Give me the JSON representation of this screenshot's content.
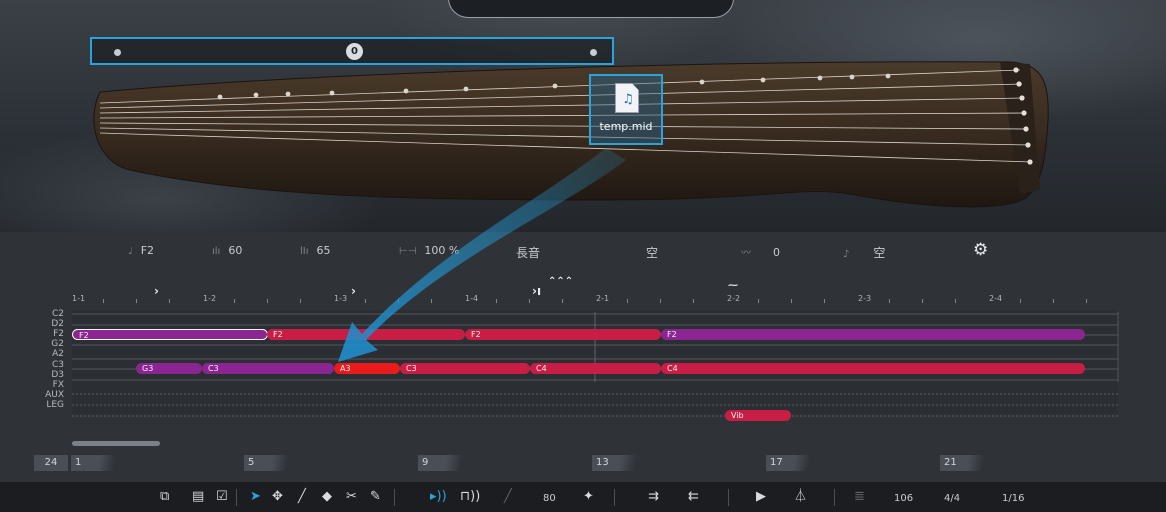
{
  "instrument": {
    "range_value": "0",
    "midi_file": {
      "name": "temp.mid",
      "icon": "midi-file-icon"
    }
  },
  "params": {
    "note": "F2",
    "velocity": "60",
    "velocity2": "65",
    "length": "100 %",
    "articulation": "長音",
    "modifier": "空",
    "vibrato": "0",
    "slide": "空",
    "icons": [
      "note-icon",
      "velocity-icon",
      "velocity-range-icon",
      "length-icon",
      "vibrato-icon",
      "slide-icon",
      "settings-icon"
    ]
  },
  "ruler": {
    "bars": [
      "1-1",
      "1-2",
      "1-3",
      "1-4",
      "2-1",
      "2-2",
      "2-3",
      "2-4"
    ]
  },
  "rows": [
    "C2",
    "D2",
    "F2",
    "G2",
    "A2",
    "C3",
    "D3",
    "FX",
    "AUX",
    "LEG"
  ],
  "notes": [
    {
      "label": "F2",
      "color": "purple",
      "selected": true
    },
    {
      "label": "F2",
      "color": "red"
    },
    {
      "label": "F2",
      "color": "red"
    },
    {
      "label": "F2",
      "color": "purple"
    },
    {
      "label": "G3",
      "color": "purple"
    },
    {
      "label": "C3",
      "color": "purple"
    },
    {
      "label": "A3",
      "color": "red-bright"
    },
    {
      "label": "C3",
      "color": "red"
    },
    {
      "label": "C4",
      "color": "red"
    },
    {
      "label": "C4",
      "color": "red"
    },
    {
      "label": "Vib",
      "color": "red"
    }
  ],
  "timeline": {
    "first": "24",
    "markers": [
      "1",
      "5",
      "9",
      "13",
      "17",
      "21"
    ]
  },
  "toolbar": {
    "velocity_value": "80",
    "tempo": "106",
    "time_signature": "4/4",
    "quantize": "1/16"
  }
}
